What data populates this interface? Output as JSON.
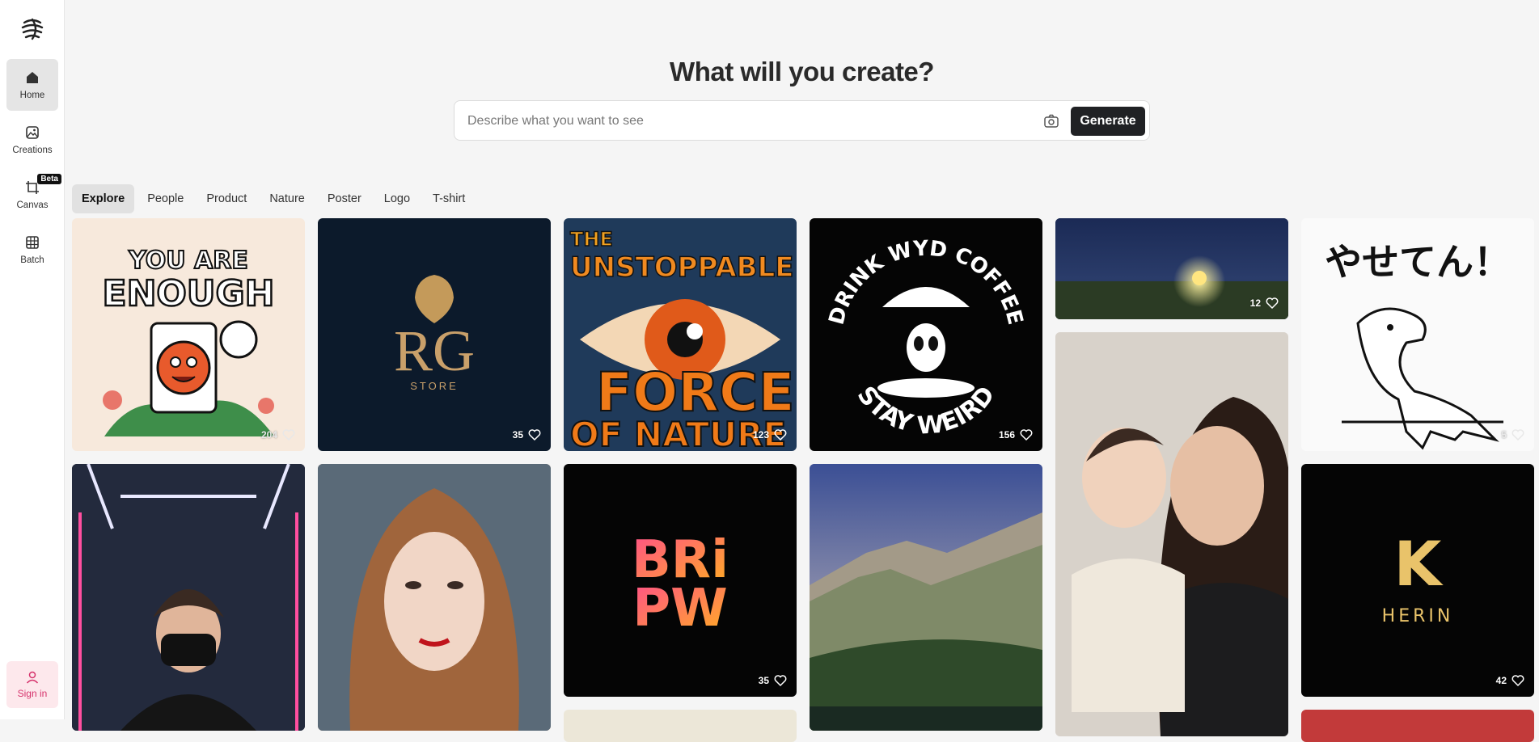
{
  "sidebar": {
    "items": [
      {
        "label": "Home"
      },
      {
        "label": "Creations"
      },
      {
        "label": "Canvas",
        "badge": "Beta"
      },
      {
        "label": "Batch"
      }
    ],
    "signin": "Sign in"
  },
  "header": {
    "title": "What will you create?",
    "search_placeholder": "Describe what you want to see",
    "generate": "Generate"
  },
  "tabs": [
    "Explore",
    "People",
    "Product",
    "Nature",
    "Poster",
    "Logo",
    "T-shirt"
  ],
  "gallery": {
    "you_are_enough": {
      "text_line1": "YOU ARE",
      "text_line2": "ENOUGH",
      "likes": "204"
    },
    "rg_store": {
      "mark": "RG",
      "sub": "STORE",
      "likes": "35"
    },
    "force_of_nature": {
      "line1": "THE",
      "line2": "UNSTOPPABLE",
      "line3": "FORCE",
      "line4": "OF NATURE",
      "likes": "123"
    },
    "drink_coffee": {
      "top": "DRINK WYD COFFEE",
      "bottom": "STAY WEIRD",
      "likes": "156"
    },
    "night_tree": {
      "likes": "12"
    },
    "dino": {
      "text": "やせてん！",
      "likes": "5"
    },
    "bripw": {
      "line1": "BRi",
      "line2": "PW",
      "likes": "35"
    },
    "herin": {
      "mark": "K",
      "name": "HERIN",
      "likes": "42"
    }
  },
  "colors": {
    "accent": "#202124",
    "signin_bg": "#fde8ec",
    "signin_fg": "#d6336c"
  }
}
